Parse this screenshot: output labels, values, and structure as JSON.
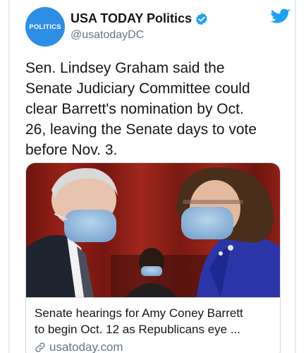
{
  "account": {
    "avatar_text": "POLITICS",
    "display_name": "USA TODAY Politics",
    "handle": "@usatodayDC",
    "verified": true
  },
  "tweet": {
    "text_lines": [
      "Sen. Lindsey Graham said the",
      "Senate Judiciary Committee could",
      "clear Barrett's nomination by Oct.",
      "26, leaving the Senate days to vote",
      "before Nov. 3."
    ]
  },
  "link_card": {
    "title_lines": [
      "Senate hearings for Amy Coney Barrett",
      "to begin Oct. 12 as Republicans eye ..."
    ],
    "domain": "usatoday.com"
  },
  "colors": {
    "brand_blue": "#1da1f2",
    "avatar_blue": "#2d8ee6",
    "secondary_text": "#657786"
  },
  "icons": [
    "verified-badge-icon",
    "twitter-bird-icon",
    "link-icon"
  ]
}
